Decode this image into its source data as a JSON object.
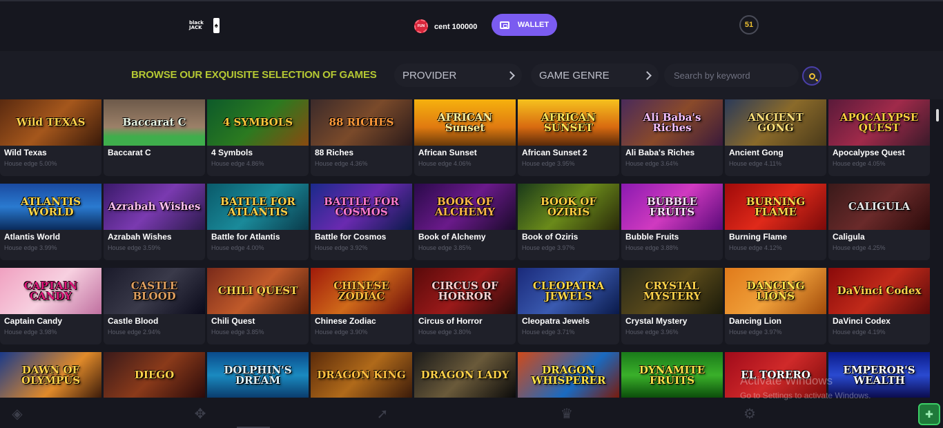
{
  "header": {
    "logo_text": "black JACK",
    "logo_card": "♠",
    "coin_label": "FUN",
    "balance": "cent 100000",
    "wallet_label": "WALLET",
    "notifications": "51"
  },
  "filters": {
    "title": "BROWSE OUR EXQUISITE SELECTION OF GAMES",
    "provider_label": "PROVIDER",
    "genre_label": "GAME GENRE",
    "search_placeholder": "Search by keyword"
  },
  "games": [
    {
      "name": "Wild Texas",
      "edge": "House edge 5.00%",
      "art": "Wild TEXAS",
      "bg": "linear-gradient(135deg,#5a2a10,#a5571c 50%,#3a1a0a)",
      "fg": "#ffd24a"
    },
    {
      "name": "Baccarat C",
      "edge": "",
      "art": "Baccarat C",
      "bg": "linear-gradient(180deg,#6d5a4a,#9c8068 60%,#3fae4c 80%)",
      "fg": "#eaf7e6"
    },
    {
      "name": "4 Symbols",
      "edge": "House edge 4.86%",
      "art": "4 SYMBOLS",
      "bg": "linear-gradient(135deg,#0d5a2a,#2b7a20 50%,#8a4a10)",
      "fg": "#ffc83a"
    },
    {
      "name": "88 Riches",
      "edge": "House edge 4.36%",
      "art": "88 RICHES",
      "bg": "linear-gradient(135deg,#3b2a2a,#7a4a2a 50%,#2a1a1a)",
      "fg": "#ff9a3a"
    },
    {
      "name": "African Sunset",
      "edge": "House edge 4.06%",
      "art": "AFRICAN Sunset",
      "bg": "linear-gradient(180deg,#f6b10e,#e07a10 60%,#6a3a0a)",
      "fg": "#fff2a0"
    },
    {
      "name": "African Sunset 2",
      "edge": "House edge 3.95%",
      "art": "AFRICAN SUNSET",
      "bg": "linear-gradient(180deg,#f6c21e,#d86a10 60%,#5a2a0a)",
      "fg": "#ffe75a"
    },
    {
      "name": "Ali Baba's Riches",
      "edge": "House edge 3.64%",
      "art": "Ali Baba's Riches",
      "bg": "linear-gradient(135deg,#4a2a5a,#8a4a2a 50%,#3a1a3a)",
      "fg": "#f7c2ff"
    },
    {
      "name": "Ancient Gong",
      "edge": "House edge 4.11%",
      "art": "ANCIENT GONG",
      "bg": "linear-gradient(135deg,#2a3a5a,#8a6a2a 50%,#4a3a1a)",
      "fg": "#ffe27a"
    },
    {
      "name": "Apocalypse Quest",
      "edge": "House edge 4.05%",
      "art": "APOCALYPSE QUEST",
      "bg": "linear-gradient(135deg,#5a1a3a,#a02a4a 50%,#3a1a2a)",
      "fg": "#ffcf40"
    },
    {
      "name": "Atlantis World",
      "edge": "House edge 3.99%",
      "art": "ATLANTIS WORLD",
      "bg": "linear-gradient(180deg,#1a4aa0,#2a7ad0 50%,#0a2a5a)",
      "fg": "#ffd84a"
    },
    {
      "name": "Azrabah Wishes",
      "edge": "House edge 3.59%",
      "art": "Azrabah Wishes",
      "bg": "linear-gradient(135deg,#3a1a6a,#7a3ab0 50%,#2a1a4a)",
      "fg": "#ffc0f0"
    },
    {
      "name": "Battle for Atlantis",
      "edge": "House edge 4.00%",
      "art": "BATTLE FOR ATLANTIS",
      "bg": "linear-gradient(135deg,#0a5a6a,#1a8a9a 50%,#0a3a4a)",
      "fg": "#ffd24a"
    },
    {
      "name": "Battle for Cosmos",
      "edge": "House edge 3.92%",
      "art": "BATTLE FOR COSMOS",
      "bg": "linear-gradient(135deg,#1a2a8a,#6a2ab0 50%,#0a1a4a)",
      "fg": "#ff7ad0"
    },
    {
      "name": "Book of Alchemy",
      "edge": "House edge 3.85%",
      "art": "BOOK OF ALCHEMY",
      "bg": "linear-gradient(135deg,#2a0a4a,#6a1a8a 50%,#1a0a2a)",
      "fg": "#ffb84a"
    },
    {
      "name": "Book of Oziris",
      "edge": "House edge 3.97%",
      "art": "BOOK OF OZIRIS",
      "bg": "linear-gradient(135deg,#1a3a1a,#6a8a1a 50%,#2a2a0a)",
      "fg": "#ffcf40"
    },
    {
      "name": "Bubble Fruits",
      "edge": "House edge 3.88%",
      "art": "BUBBLE FRUITS",
      "bg": "linear-gradient(135deg,#8a1ab0,#d03ac0 50%,#5a0a7a)",
      "fg": "#ffe0ff"
    },
    {
      "name": "Burning Flame",
      "edge": "House edge 4.12%",
      "art": "BURNING FLAME",
      "bg": "linear-gradient(135deg,#a00a0a,#e02a1a 50%,#7a0a0a)",
      "fg": "#ffd84a"
    },
    {
      "name": "Caligula",
      "edge": "House edge 4.25%",
      "art": "CALIGULA",
      "bg": "linear-gradient(135deg,#3a1a1a,#6a2a2a 50%,#2a0a0a)",
      "fg": "#e8e8e8"
    },
    {
      "name": "Captain Candy",
      "edge": "House edge 3.98%",
      "art": "CAPTAIN CANDY",
      "bg": "linear-gradient(135deg,#f0a0c0,#f7d0e0 50%,#c070a0)",
      "fg": "#e0157a"
    },
    {
      "name": "Castle Blood",
      "edge": "House edge 2.94%",
      "art": "CASTLE BLOOD",
      "bg": "linear-gradient(135deg,#1a1a2a,#3a3a4a 50%,#0a0a1a)",
      "fg": "#e0a060"
    },
    {
      "name": "Chili Quest",
      "edge": "House edge 3.85%",
      "art": "CHILI QUEST",
      "bg": "linear-gradient(135deg,#7a2a1a,#c05a2a 50%,#4a1a0a)",
      "fg": "#ffd24a"
    },
    {
      "name": "Chinese Zodiac",
      "edge": "House edge 3.90%",
      "art": "CHINESE ZODIAC",
      "bg": "linear-gradient(135deg,#a01a0a,#d06a1a 50%,#6a0a0a)",
      "fg": "#ffc040"
    },
    {
      "name": "Circus of Horror",
      "edge": "House edge 3.80%",
      "art": "CIRCUS OF HORROR",
      "bg": "linear-gradient(135deg,#5a0a0a,#9a1a1a 50%,#2a0a0a)",
      "fg": "#ffd0d0"
    },
    {
      "name": "Cleopatra Jewels",
      "edge": "House edge 3.71%",
      "art": "CLEOPATRA JEWELS",
      "bg": "linear-gradient(135deg,#1a2a7a,#3a5ab0 50%,#0a1a4a)",
      "fg": "#ffd84a"
    },
    {
      "name": "Crystal Mystery",
      "edge": "House edge 3.96%",
      "art": "CRYSTAL MYSTERY",
      "bg": "linear-gradient(135deg,#2a2a1a,#5a4a1a 50%,#1a1a0a)",
      "fg": "#ffd24a"
    },
    {
      "name": "Dancing Lion",
      "edge": "House edge 3.97%",
      "art": "DANCING LIONS",
      "bg": "linear-gradient(135deg,#e07a1a,#f0a03a 50%,#a04a0a)",
      "fg": "#ffe24a"
    },
    {
      "name": "DaVinci Codex",
      "edge": "House edge 4.19%",
      "art": "DaVinci Codex",
      "bg": "linear-gradient(135deg,#8a0a0a,#c02a1a 50%,#5a0a0a)",
      "fg": "#ffd24a"
    },
    {
      "name": "",
      "edge": "",
      "art": "DAWN OF OLYMPUS",
      "bg": "linear-gradient(135deg,#1a3a8a,#e08a2a 60%,#3a1a0a)",
      "fg": "#ffd24a"
    },
    {
      "name": "",
      "edge": "",
      "art": "DIEGO",
      "bg": "linear-gradient(135deg,#3a1a1a,#8a3a1a 50%,#2a0a0a)",
      "fg": "#ffd24a"
    },
    {
      "name": "",
      "edge": "",
      "art": "DOLPHIN'S DREAM",
      "bg": "linear-gradient(180deg,#0a4a8a,#1a8ac0 50%,#0a3a6a)",
      "fg": "#e0f4ff"
    },
    {
      "name": "",
      "edge": "",
      "art": "DRAGON KING",
      "bg": "linear-gradient(135deg,#5a2a0a,#b06a1a 50%,#3a1a0a)",
      "fg": "#ffc040"
    },
    {
      "name": "",
      "edge": "",
      "art": "DRAGON LADY",
      "bg": "linear-gradient(135deg,#1a1a1a,#6a5a3a 50%,#0a0a0a)",
      "fg": "#ffd24a"
    },
    {
      "name": "",
      "edge": "",
      "art": "DRAGON WHISPERER",
      "bg": "linear-gradient(135deg,#d04a1a,#1a6ac0 60%,#7a1a0a)",
      "fg": "#ffe24a"
    },
    {
      "name": "",
      "edge": "",
      "art": "DYNAMITE FRUITS",
      "bg": "linear-gradient(180deg,#1a7a1a,#3ab02a 50%,#0a4a0a)",
      "fg": "#ffe24a"
    },
    {
      "name": "",
      "edge": "",
      "art": "EL TORERO",
      "bg": "linear-gradient(135deg,#a00a1a,#d02a2a 50%,#7a0a0a)",
      "fg": "#ffffff"
    },
    {
      "name": "",
      "edge": "",
      "art": "EMPEROR'S WEALTH",
      "bg": "linear-gradient(180deg,#0a1a8a,#2a4ad0 50%,#0a0a4a)",
      "fg": "#ffffff"
    }
  ],
  "bottom_nav": {
    "icons": [
      "diamond-icon",
      "crown-icon",
      "rocket-icon",
      "trophy-icon",
      "gear-icon"
    ]
  },
  "watermark": {
    "line1": "Activate Windows",
    "line2": "Go to Settings to activate Windows."
  }
}
